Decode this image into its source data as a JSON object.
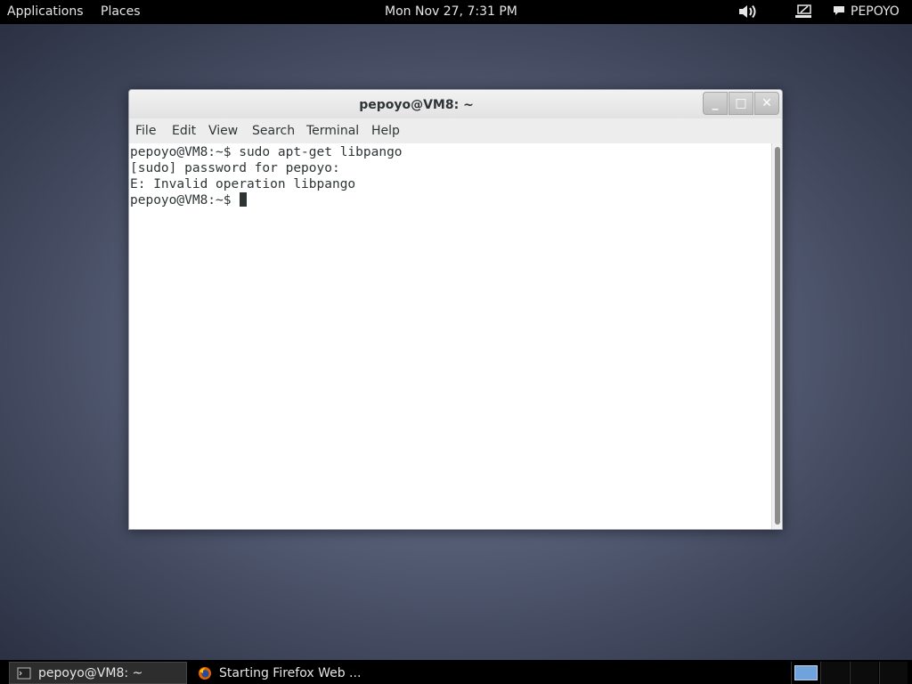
{
  "top_panel": {
    "applications": "Applications",
    "places": "Places",
    "clock": "Mon Nov 27,  7:31 PM",
    "user": "PEPOYO",
    "icons": [
      "volume-icon",
      "network-icon",
      "chat-icon"
    ]
  },
  "window": {
    "title": "pepoyo@VM8: ~",
    "buttons": {
      "minimize": "_",
      "maximize": "□",
      "close": "✕"
    },
    "menu": [
      "File",
      "Edit",
      "View",
      "Search",
      "Terminal",
      "Help"
    ],
    "lines": [
      "pepoyo@VM8:~$ sudo apt-get libpango",
      "[sudo] password for pepoyo:",
      "E: Invalid operation libpango",
      "pepoyo@VM8:~$ "
    ]
  },
  "taskbar": {
    "tasks": [
      {
        "label": "pepoyo@VM8: ~",
        "icon": "terminal-icon"
      },
      {
        "label": "Starting Firefox Web ...",
        "icon": "firefox-icon"
      }
    ],
    "workspaces": 4,
    "active_workspace": 1
  },
  "colors": {
    "panel": "#000000",
    "workspace_active": "#6fa3d9",
    "terminal_text": "#2e3436"
  }
}
